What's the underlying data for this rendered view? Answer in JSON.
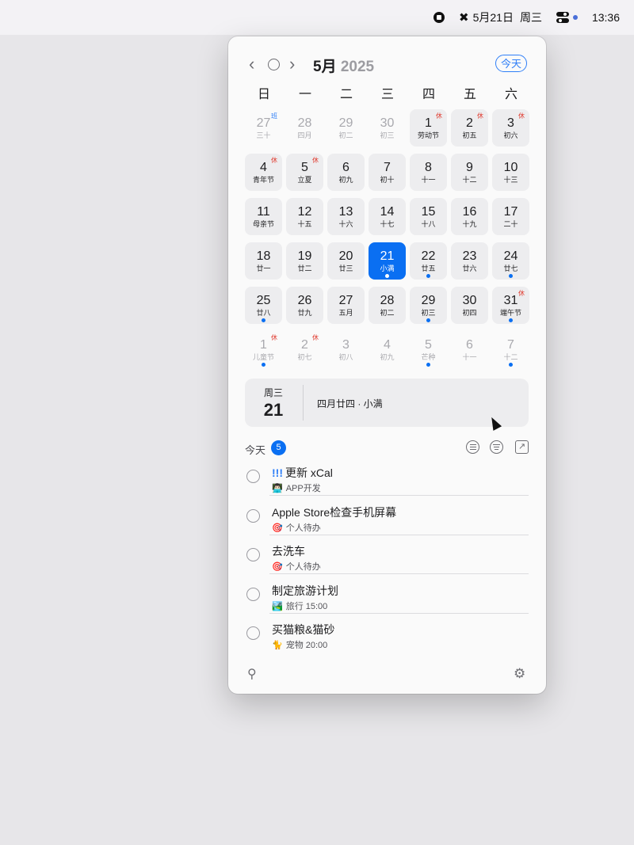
{
  "menubar": {
    "date": "5月21日",
    "weekday": "周三",
    "time": "13:36",
    "icons": [
      "stop-icon",
      "xcal-icon",
      "control-center-icon"
    ]
  },
  "calendar": {
    "month": "5月",
    "year": "2025",
    "today_button": "今天",
    "weekdays": [
      "日",
      "一",
      "二",
      "三",
      "四",
      "五",
      "六"
    ],
    "rows": [
      [
        {
          "d": "27",
          "l": "三十",
          "out": true,
          "badge": "班",
          "badge_type": "work"
        },
        {
          "d": "28",
          "l": "四月",
          "out": true
        },
        {
          "d": "29",
          "l": "初二",
          "out": true
        },
        {
          "d": "30",
          "l": "初三",
          "out": true
        },
        {
          "d": "1",
          "l": "劳动节",
          "badge": "休",
          "badge_type": "holiday",
          "bg": true
        },
        {
          "d": "2",
          "l": "初五",
          "badge": "休",
          "badge_type": "holiday",
          "bg": true
        },
        {
          "d": "3",
          "l": "初六",
          "badge": "休",
          "badge_type": "holiday",
          "bg": true
        }
      ],
      [
        {
          "d": "4",
          "l": "青年节",
          "badge": "休",
          "badge_type": "holiday",
          "bg": true
        },
        {
          "d": "5",
          "l": "立夏",
          "badge": "休",
          "badge_type": "holiday",
          "bg": true
        },
        {
          "d": "6",
          "l": "初九",
          "bg": true
        },
        {
          "d": "7",
          "l": "初十",
          "bg": true
        },
        {
          "d": "8",
          "l": "十一",
          "bg": true
        },
        {
          "d": "9",
          "l": "十二",
          "bg": true
        },
        {
          "d": "10",
          "l": "十三",
          "bg": true
        }
      ],
      [
        {
          "d": "11",
          "l": "母亲节",
          "bg": true
        },
        {
          "d": "12",
          "l": "十五",
          "bg": true
        },
        {
          "d": "13",
          "l": "十六",
          "bg": true
        },
        {
          "d": "14",
          "l": "十七",
          "bg": true
        },
        {
          "d": "15",
          "l": "十八",
          "bg": true
        },
        {
          "d": "16",
          "l": "十九",
          "bg": true
        },
        {
          "d": "17",
          "l": "二十",
          "bg": true
        }
      ],
      [
        {
          "d": "18",
          "l": "廿一",
          "bg": true
        },
        {
          "d": "19",
          "l": "廿二",
          "bg": true
        },
        {
          "d": "20",
          "l": "廿三",
          "bg": true
        },
        {
          "d": "21",
          "l": "小满",
          "bg": true,
          "selected": true,
          "dot": true
        },
        {
          "d": "22",
          "l": "廿五",
          "bg": true,
          "dot": true
        },
        {
          "d": "23",
          "l": "廿六",
          "bg": true
        },
        {
          "d": "24",
          "l": "廿七",
          "bg": true,
          "dot": true
        }
      ],
      [
        {
          "d": "25",
          "l": "廿八",
          "bg": true,
          "dot": true
        },
        {
          "d": "26",
          "l": "廿九",
          "bg": true
        },
        {
          "d": "27",
          "l": "五月",
          "bg": true
        },
        {
          "d": "28",
          "l": "初二",
          "bg": true
        },
        {
          "d": "29",
          "l": "初三",
          "bg": true,
          "dot": true
        },
        {
          "d": "30",
          "l": "初四",
          "bg": true
        },
        {
          "d": "31",
          "l": "端午节",
          "badge": "休",
          "badge_type": "holiday",
          "bg": true,
          "dot": true
        }
      ],
      [
        {
          "d": "1",
          "l": "儿童节",
          "out": true,
          "badge": "休",
          "badge_type": "holiday",
          "dot": true
        },
        {
          "d": "2",
          "l": "初七",
          "out": true,
          "badge": "休",
          "badge_type": "holiday"
        },
        {
          "d": "3",
          "l": "初八",
          "out": true
        },
        {
          "d": "4",
          "l": "初九",
          "out": true
        },
        {
          "d": "5",
          "l": "芒种",
          "out": true,
          "dot": true
        },
        {
          "d": "6",
          "l": "十一",
          "out": true
        },
        {
          "d": "7",
          "l": "十二",
          "out": true,
          "dot": true
        }
      ]
    ]
  },
  "selected_day": {
    "weekday": "周三",
    "day": "21",
    "info": "四月廿四 · 小满"
  },
  "todos": {
    "header": "今天",
    "count": "5",
    "items": [
      {
        "title": "更新 xCal",
        "priority": "!!!",
        "emoji": "👨🏻‍💻",
        "list": "APP开发",
        "time": ""
      },
      {
        "title": "Apple Store检查手机屏幕",
        "priority": "",
        "emoji": "🎯",
        "list": "个人待办",
        "time": ""
      },
      {
        "title": "去洗车",
        "priority": "",
        "emoji": "🎯",
        "list": "个人待办",
        "time": ""
      },
      {
        "title": "制定旅游计划",
        "priority": "",
        "emoji": "🏞️",
        "list": "旅行",
        "time": "15:00"
      },
      {
        "title": "买猫粮&猫砂",
        "priority": "",
        "emoji": "🐈",
        "list": "宠物",
        "time": "20:00"
      }
    ]
  },
  "colors": {
    "accent": "#0a6ff2",
    "holiday": "#e03b2f",
    "panel": "#fafafa",
    "cell": "#ededef"
  }
}
